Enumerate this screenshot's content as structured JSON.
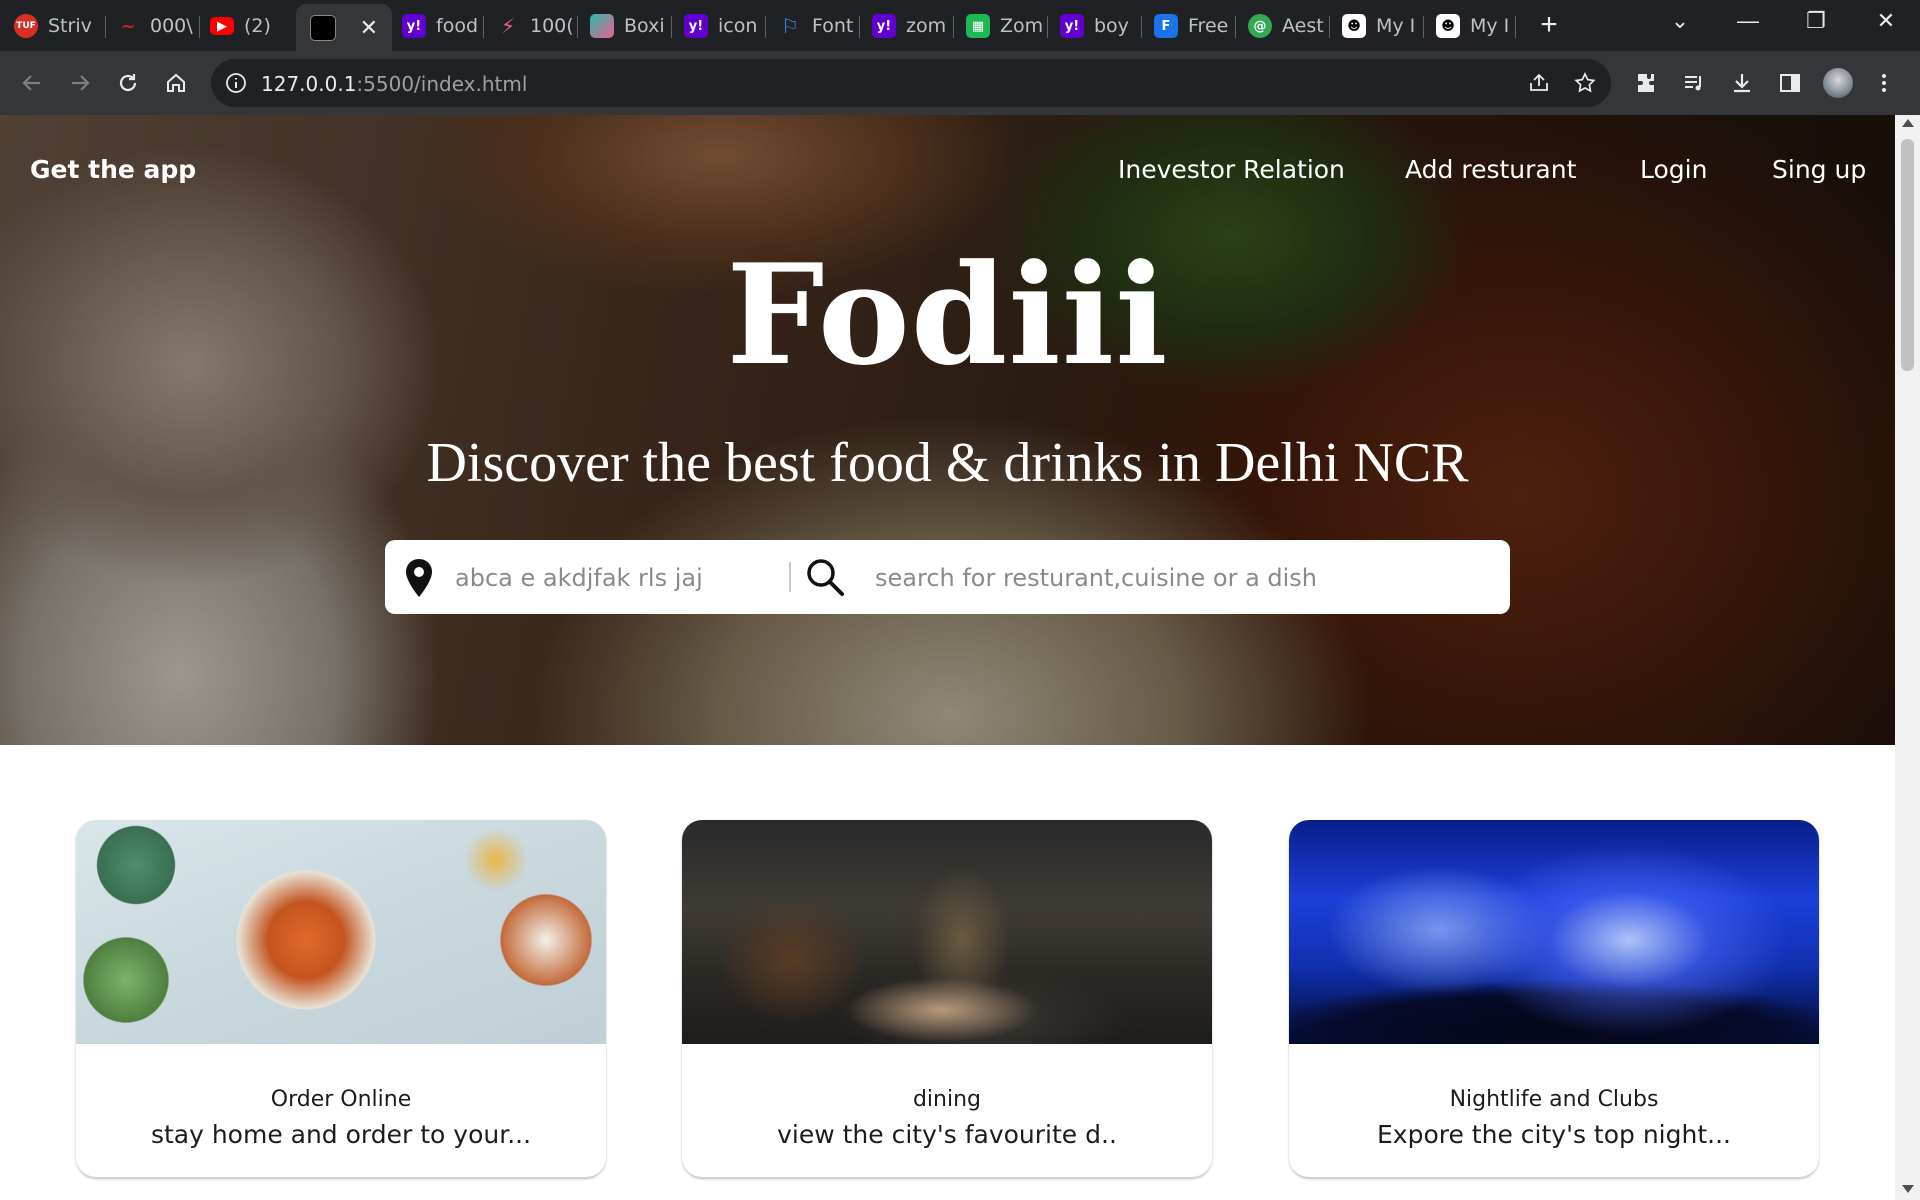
{
  "browser": {
    "tabs": [
      {
        "title": "Striv",
        "favicon": "tuf-icon",
        "color": "#d93025"
      },
      {
        "title": "000\\",
        "favicon": "squiggle-icon",
        "color": "#c5221f"
      },
      {
        "title": "(2)",
        "favicon": "youtube-icon",
        "color": "#ff0000"
      },
      {
        "title": "",
        "favicon": "page-icon",
        "color": "#202124",
        "active": true
      },
      {
        "title": "food",
        "favicon": "yahoo-icon",
        "color": "#6001d2"
      },
      {
        "title": "100(",
        "favicon": "zigzag-icon",
        "color": "#e8618c"
      },
      {
        "title": "Boxi",
        "favicon": "box-icon",
        "color": "#2bbbad"
      },
      {
        "title": "icon",
        "favicon": "yahoo-icon",
        "color": "#6001d2"
      },
      {
        "title": "Font",
        "favicon": "flag-icon",
        "color": "#4285f4"
      },
      {
        "title": "zom",
        "favicon": "yahoo-icon",
        "color": "#6001d2"
      },
      {
        "title": "Zom",
        "favicon": "green-grid-icon",
        "color": "#1db954"
      },
      {
        "title": "boy",
        "favicon": "yahoo-icon",
        "color": "#6001d2"
      },
      {
        "title": "Free",
        "favicon": "f-icon",
        "color": "#1a73e8"
      },
      {
        "title": "Aest",
        "favicon": "swirl-icon",
        "color": "#34a853"
      },
      {
        "title": "My I",
        "favicon": "avatar-icon",
        "color": "#ffffff"
      },
      {
        "title": "My I",
        "favicon": "avatar-icon",
        "color": "#ffffff"
      }
    ],
    "url_host": "127.0.0.1",
    "url_rest": ":5500/index.html"
  },
  "nav": {
    "get_app": "Get the app",
    "investor": "Inevestor Relation",
    "add_restaurant": "Add resturant",
    "login": "Login",
    "signup": "Sing up"
  },
  "hero": {
    "brand": "Fodiii",
    "tagline": "Discover the best food & drinks in Delhi NCR"
  },
  "search": {
    "location_placeholder": "abca e akdjfak rls jaj",
    "dish_placeholder": "search for resturant,cuisine or a dish"
  },
  "cards": [
    {
      "title": "Order Online",
      "subtitle": "stay home and order to your..."
    },
    {
      "title": "dining",
      "subtitle": "view the city's favourite d.."
    },
    {
      "title": "Nightlife and Clubs",
      "subtitle": "Expore the city's top night..."
    }
  ]
}
